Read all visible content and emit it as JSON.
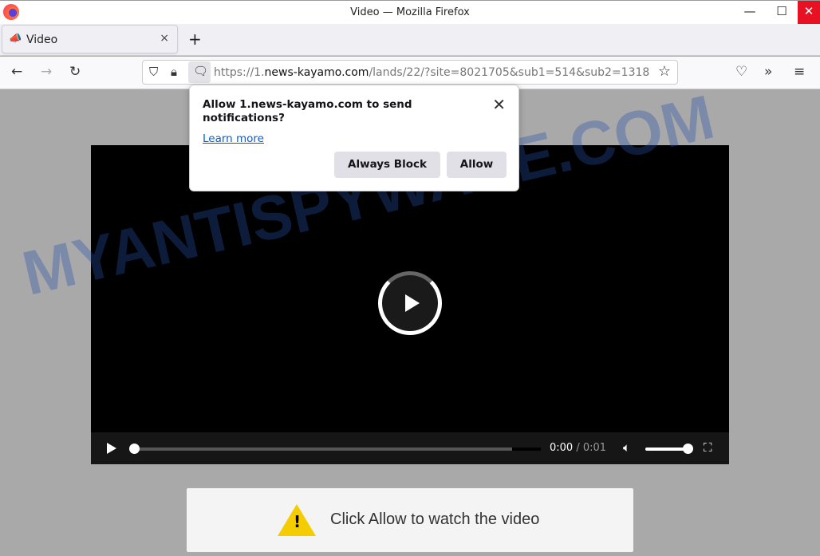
{
  "window": {
    "title": "Video — Mozilla Firefox",
    "minimize": "—",
    "maximize": "☐",
    "close": "✕"
  },
  "tab": {
    "label": "Video",
    "close": "×",
    "new_tab": "+"
  },
  "nav": {
    "back": "←",
    "forward": "→",
    "reload": "↻",
    "url_prefix": "https://1.",
    "url_domain": "news-kayamo.com",
    "url_rest": "/lands/22/?site=8021705&sub1=514&sub2=1318",
    "bookmark": "☆",
    "pocket": "♡",
    "overflow": "»",
    "menu": "≡"
  },
  "popup": {
    "message": "Allow 1.news-kayamo.com to send notifications?",
    "learn_more": "Learn more",
    "block_label": "Always Block",
    "allow_label": "Allow",
    "close": "✕"
  },
  "video": {
    "current_time": "0:00",
    "separator": "/",
    "duration": "0:01",
    "buffered_percent": 93,
    "played_percent": 0,
    "volume_percent": 100
  },
  "cta": {
    "text": "Click Allow to watch the video",
    "icon": "!"
  },
  "watermark": "MYANTISPYWARE.COM"
}
